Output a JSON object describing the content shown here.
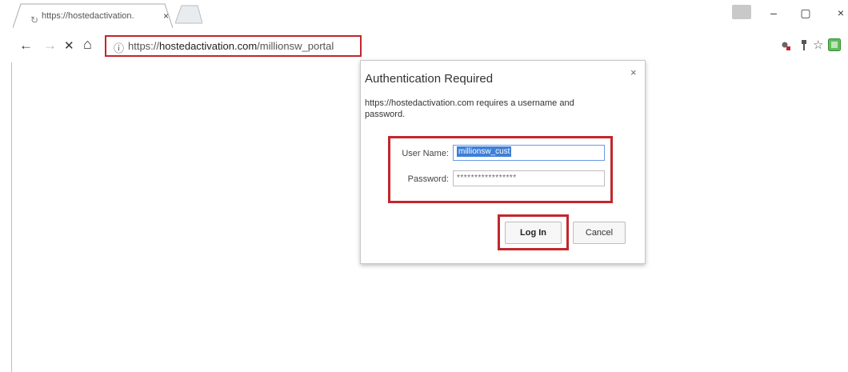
{
  "browser": {
    "tab": {
      "title": "https://hostedactivation.",
      "loading_icon": "↻",
      "close_icon": "×"
    },
    "window_controls": {
      "minimize": "–",
      "restore": "▢",
      "close": "×"
    },
    "url": {
      "scheme": "https://",
      "host": "hostedactivation.com",
      "path": "/millionsw_portal"
    },
    "nav": {
      "back": "←",
      "forward": "→",
      "stop": "✕",
      "home": "⌂",
      "info": "ⓘ"
    },
    "toolbar_icons": {
      "bookmark": "☆"
    }
  },
  "dialog": {
    "title": "Authentication Required",
    "close_icon": "×",
    "message": "https://hostedactivation.com requires a username and password.",
    "username_label": "User Name:",
    "username_value": "millionsw_cust",
    "password_label": "Password:",
    "password_value": "*****************",
    "login_label": "Log In",
    "cancel_label": "Cancel"
  },
  "highlight_color": "#c1272d"
}
